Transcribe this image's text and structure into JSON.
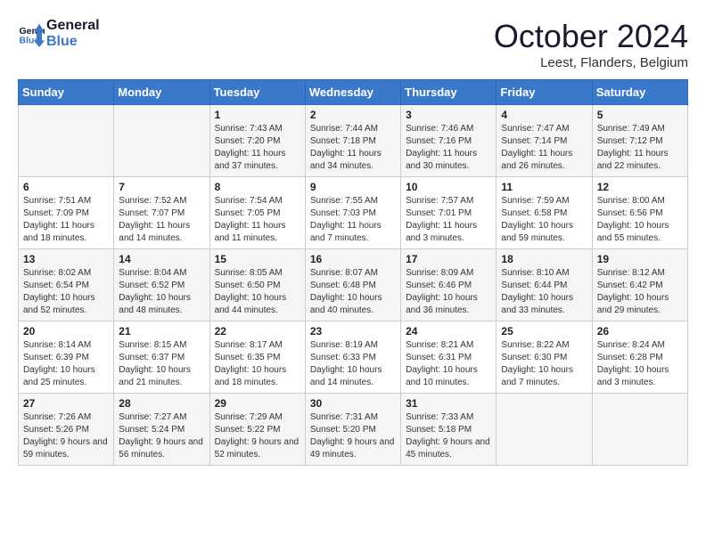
{
  "header": {
    "logo_line1": "General",
    "logo_line2": "Blue",
    "month_title": "October 2024",
    "subtitle": "Leest, Flanders, Belgium"
  },
  "days_of_week": [
    "Sunday",
    "Monday",
    "Tuesday",
    "Wednesday",
    "Thursday",
    "Friday",
    "Saturday"
  ],
  "weeks": [
    [
      {
        "num": "",
        "sunrise": "",
        "sunset": "",
        "daylight": ""
      },
      {
        "num": "",
        "sunrise": "",
        "sunset": "",
        "daylight": ""
      },
      {
        "num": "1",
        "sunrise": "Sunrise: 7:43 AM",
        "sunset": "Sunset: 7:20 PM",
        "daylight": "Daylight: 11 hours and 37 minutes."
      },
      {
        "num": "2",
        "sunrise": "Sunrise: 7:44 AM",
        "sunset": "Sunset: 7:18 PM",
        "daylight": "Daylight: 11 hours and 34 minutes."
      },
      {
        "num": "3",
        "sunrise": "Sunrise: 7:46 AM",
        "sunset": "Sunset: 7:16 PM",
        "daylight": "Daylight: 11 hours and 30 minutes."
      },
      {
        "num": "4",
        "sunrise": "Sunrise: 7:47 AM",
        "sunset": "Sunset: 7:14 PM",
        "daylight": "Daylight: 11 hours and 26 minutes."
      },
      {
        "num": "5",
        "sunrise": "Sunrise: 7:49 AM",
        "sunset": "Sunset: 7:12 PM",
        "daylight": "Daylight: 11 hours and 22 minutes."
      }
    ],
    [
      {
        "num": "6",
        "sunrise": "Sunrise: 7:51 AM",
        "sunset": "Sunset: 7:09 PM",
        "daylight": "Daylight: 11 hours and 18 minutes."
      },
      {
        "num": "7",
        "sunrise": "Sunrise: 7:52 AM",
        "sunset": "Sunset: 7:07 PM",
        "daylight": "Daylight: 11 hours and 14 minutes."
      },
      {
        "num": "8",
        "sunrise": "Sunrise: 7:54 AM",
        "sunset": "Sunset: 7:05 PM",
        "daylight": "Daylight: 11 hours and 11 minutes."
      },
      {
        "num": "9",
        "sunrise": "Sunrise: 7:55 AM",
        "sunset": "Sunset: 7:03 PM",
        "daylight": "Daylight: 11 hours and 7 minutes."
      },
      {
        "num": "10",
        "sunrise": "Sunrise: 7:57 AM",
        "sunset": "Sunset: 7:01 PM",
        "daylight": "Daylight: 11 hours and 3 minutes."
      },
      {
        "num": "11",
        "sunrise": "Sunrise: 7:59 AM",
        "sunset": "Sunset: 6:58 PM",
        "daylight": "Daylight: 10 hours and 59 minutes."
      },
      {
        "num": "12",
        "sunrise": "Sunrise: 8:00 AM",
        "sunset": "Sunset: 6:56 PM",
        "daylight": "Daylight: 10 hours and 55 minutes."
      }
    ],
    [
      {
        "num": "13",
        "sunrise": "Sunrise: 8:02 AM",
        "sunset": "Sunset: 6:54 PM",
        "daylight": "Daylight: 10 hours and 52 minutes."
      },
      {
        "num": "14",
        "sunrise": "Sunrise: 8:04 AM",
        "sunset": "Sunset: 6:52 PM",
        "daylight": "Daylight: 10 hours and 48 minutes."
      },
      {
        "num": "15",
        "sunrise": "Sunrise: 8:05 AM",
        "sunset": "Sunset: 6:50 PM",
        "daylight": "Daylight: 10 hours and 44 minutes."
      },
      {
        "num": "16",
        "sunrise": "Sunrise: 8:07 AM",
        "sunset": "Sunset: 6:48 PM",
        "daylight": "Daylight: 10 hours and 40 minutes."
      },
      {
        "num": "17",
        "sunrise": "Sunrise: 8:09 AM",
        "sunset": "Sunset: 6:46 PM",
        "daylight": "Daylight: 10 hours and 36 minutes."
      },
      {
        "num": "18",
        "sunrise": "Sunrise: 8:10 AM",
        "sunset": "Sunset: 6:44 PM",
        "daylight": "Daylight: 10 hours and 33 minutes."
      },
      {
        "num": "19",
        "sunrise": "Sunrise: 8:12 AM",
        "sunset": "Sunset: 6:42 PM",
        "daylight": "Daylight: 10 hours and 29 minutes."
      }
    ],
    [
      {
        "num": "20",
        "sunrise": "Sunrise: 8:14 AM",
        "sunset": "Sunset: 6:39 PM",
        "daylight": "Daylight: 10 hours and 25 minutes."
      },
      {
        "num": "21",
        "sunrise": "Sunrise: 8:15 AM",
        "sunset": "Sunset: 6:37 PM",
        "daylight": "Daylight: 10 hours and 21 minutes."
      },
      {
        "num": "22",
        "sunrise": "Sunrise: 8:17 AM",
        "sunset": "Sunset: 6:35 PM",
        "daylight": "Daylight: 10 hours and 18 minutes."
      },
      {
        "num": "23",
        "sunrise": "Sunrise: 8:19 AM",
        "sunset": "Sunset: 6:33 PM",
        "daylight": "Daylight: 10 hours and 14 minutes."
      },
      {
        "num": "24",
        "sunrise": "Sunrise: 8:21 AM",
        "sunset": "Sunset: 6:31 PM",
        "daylight": "Daylight: 10 hours and 10 minutes."
      },
      {
        "num": "25",
        "sunrise": "Sunrise: 8:22 AM",
        "sunset": "Sunset: 6:30 PM",
        "daylight": "Daylight: 10 hours and 7 minutes."
      },
      {
        "num": "26",
        "sunrise": "Sunrise: 8:24 AM",
        "sunset": "Sunset: 6:28 PM",
        "daylight": "Daylight: 10 hours and 3 minutes."
      }
    ],
    [
      {
        "num": "27",
        "sunrise": "Sunrise: 7:26 AM",
        "sunset": "Sunset: 5:26 PM",
        "daylight": "Daylight: 9 hours and 59 minutes."
      },
      {
        "num": "28",
        "sunrise": "Sunrise: 7:27 AM",
        "sunset": "Sunset: 5:24 PM",
        "daylight": "Daylight: 9 hours and 56 minutes."
      },
      {
        "num": "29",
        "sunrise": "Sunrise: 7:29 AM",
        "sunset": "Sunset: 5:22 PM",
        "daylight": "Daylight: 9 hours and 52 minutes."
      },
      {
        "num": "30",
        "sunrise": "Sunrise: 7:31 AM",
        "sunset": "Sunset: 5:20 PM",
        "daylight": "Daylight: 9 hours and 49 minutes."
      },
      {
        "num": "31",
        "sunrise": "Sunrise: 7:33 AM",
        "sunset": "Sunset: 5:18 PM",
        "daylight": "Daylight: 9 hours and 45 minutes."
      },
      {
        "num": "",
        "sunrise": "",
        "sunset": "",
        "daylight": ""
      },
      {
        "num": "",
        "sunrise": "",
        "sunset": "",
        "daylight": ""
      }
    ]
  ]
}
